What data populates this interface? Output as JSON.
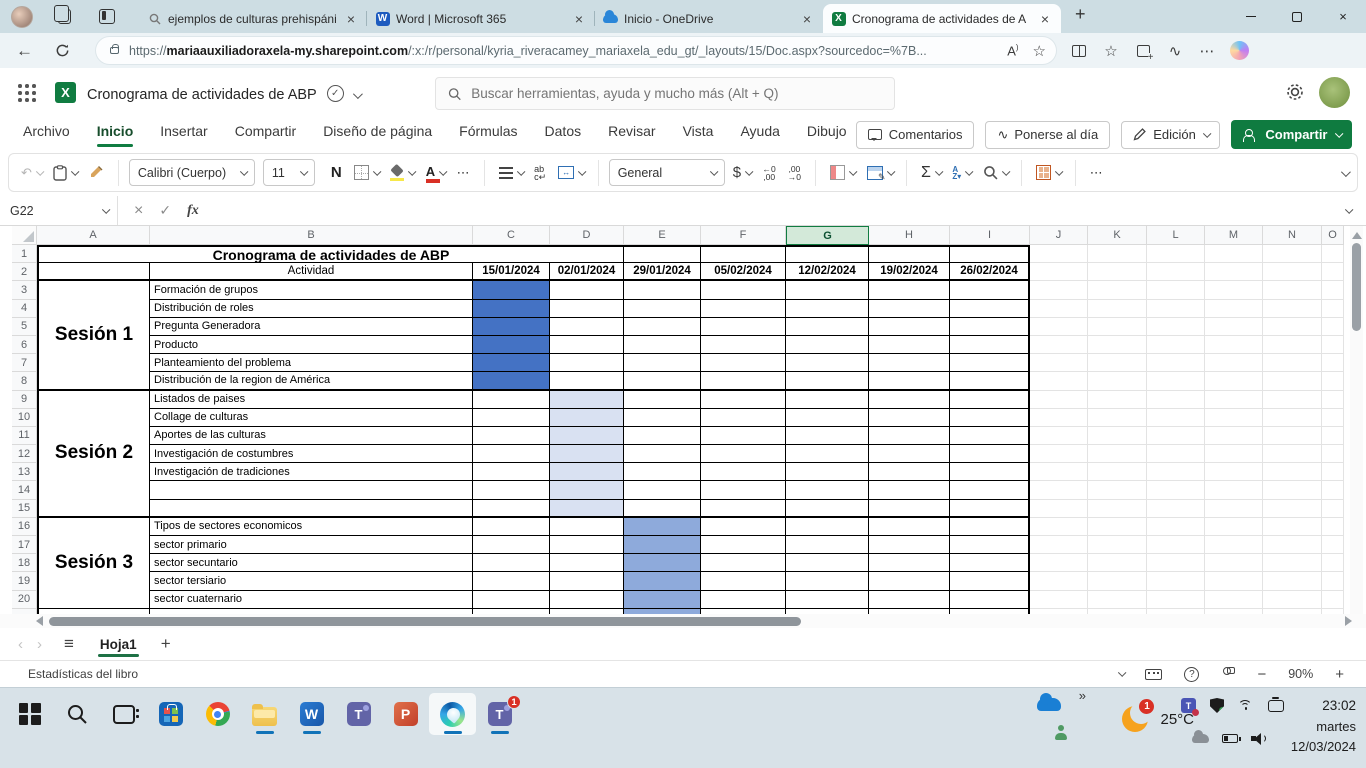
{
  "icons": {
    "close": "×",
    "check": "✓",
    "star": "☆",
    "back": "←",
    "sigma": "Σ",
    "dollar": "$",
    "more": "⋯",
    "all_sheets": "≡",
    "plus": "+",
    "minus": "−",
    "prev": "‹",
    "next": "›",
    "help": "?",
    "read_aloud": "A",
    "fx": "fx",
    "bold": "N",
    "wrap_lines": "ab¬",
    "dec_inc": "←.0\n.00",
    "dec_dec": ".00\n→.0",
    "sort_az": "A\nZ▾",
    "catch_up_glyph": "∿"
  },
  "browser": {
    "tabs": [
      {
        "title": "ejemplos de culturas prehispánic",
        "icon": "search-icon",
        "active": false
      },
      {
        "title": "Word | Microsoft 365",
        "icon": "word-icon",
        "active": false
      },
      {
        "title": "Inicio - OneDrive",
        "icon": "onedrive-icon",
        "active": false
      },
      {
        "title": "Cronograma de actividades de A",
        "icon": "excel-icon",
        "active": true
      }
    ],
    "url_prefix": "https://",
    "url_domain": "mariaauxiliadoraxela-my.sharepoint.com",
    "url_rest": "/:x:/r/personal/kyria_riveracamey_mariaxela_edu_gt/_layouts/15/Doc.aspx?sourcedoc=%7B..."
  },
  "app": {
    "title": "Cronograma de actividades de ABP",
    "search_placeholder": "Buscar herramientas, ayuda y mucho más (Alt + Q)",
    "menu": {
      "items": [
        "Archivo",
        "Inicio",
        "Insertar",
        "Compartir",
        "Diseño de página",
        "Fórmulas",
        "Datos",
        "Revisar",
        "Vista",
        "Ayuda",
        "Dibujo"
      ],
      "active": "Inicio"
    },
    "actions": {
      "comments": "Comentarios",
      "catch_up": "Ponerse al día",
      "editing": "Edición",
      "share": "Compartir"
    },
    "toolbar": {
      "font_name": "Calibri (Cuerpo)",
      "font_size": "11",
      "number_format": "General"
    },
    "formula_bar": {
      "name_box": "G22",
      "value": ""
    }
  },
  "sheet": {
    "columns": [
      "A",
      "B",
      "C",
      "D",
      "E",
      "F",
      "G",
      "H",
      "I",
      "J",
      "K",
      "L",
      "M",
      "N",
      "O"
    ],
    "selected_column": "G",
    "visible_rows": 20,
    "title": "Cronograma de actividades de ABP",
    "activity_header": "Actividad",
    "dates": [
      "15/01/2024",
      "02/01/2024",
      "29/01/2024",
      "05/02/2024",
      "12/02/2024",
      "19/02/2024",
      "26/02/2024"
    ],
    "sections": [
      {
        "name": "Sesión 1",
        "fill_column": "C",
        "fill_color": "#4472c4",
        "rows": [
          "Formación de grupos",
          "Distribución de roles",
          "Pregunta Generadora",
          "Producto",
          "Planteamiento del problema",
          "Distribución de la region de América"
        ]
      },
      {
        "name": "Sesión 2",
        "fill_column": "D",
        "fill_color": "#d9e1f2",
        "rows": [
          "Listados de paises",
          "Collage de culturas",
          "Aportes de las culturas",
          "Investigación de costumbres",
          "Investigación de tradiciones",
          "",
          ""
        ]
      },
      {
        "name": "Sesión 3",
        "fill_column": "E",
        "fill_color": "#8eaadb",
        "rows": [
          "Tipos de sectores economicos",
          "sector primario",
          "sector secuntario",
          "sector tersiario",
          "sector cuaternario"
        ]
      }
    ]
  },
  "sheet_bar": {
    "tab": "Hoja1"
  },
  "status_bar": {
    "left": "Estadísticas del libro",
    "zoom": "90%"
  },
  "taskbar": {
    "apps": [
      {
        "name": "start"
      },
      {
        "name": "search"
      },
      {
        "name": "task-view"
      },
      {
        "name": "store"
      },
      {
        "name": "chrome"
      },
      {
        "name": "file-explorer",
        "running": true
      },
      {
        "name": "word",
        "running": true
      },
      {
        "name": "teams"
      },
      {
        "name": "powerpoint"
      },
      {
        "name": "edge",
        "running": true,
        "active": true
      },
      {
        "name": "teams-work",
        "running": true,
        "badge": "1"
      }
    ],
    "overflow": "»",
    "weather": {
      "temp": "25°C",
      "badge": "1"
    },
    "clock": {
      "time": "23:02",
      "day": "martes",
      "date": "12/03/2024"
    }
  }
}
